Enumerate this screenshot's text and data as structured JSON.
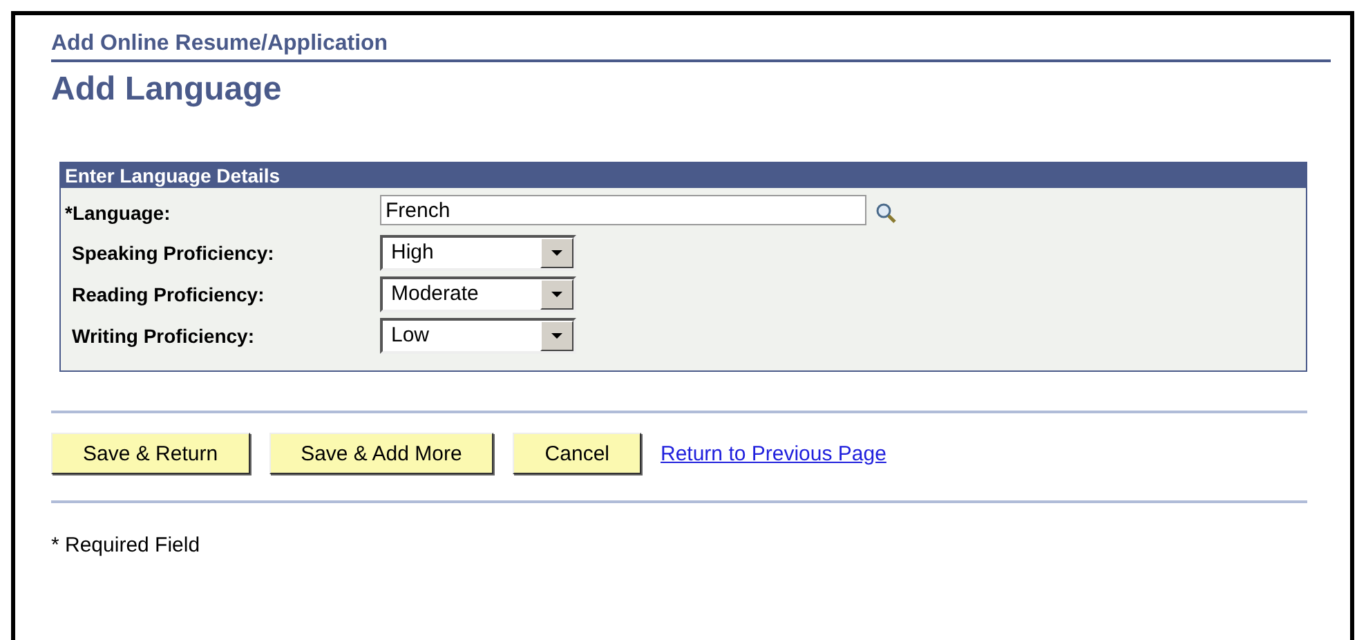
{
  "page": {
    "breadcrumb": "Add Online Resume/Application",
    "title": "Add Language"
  },
  "section": {
    "title": "Enter Language Details",
    "fields": [
      {
        "kind": "lookup",
        "label": "*Language:",
        "value": "French"
      },
      {
        "kind": "dropdown",
        "label": "Speaking Proficiency:",
        "value": "High"
      },
      {
        "kind": "dropdown",
        "label": "Reading Proficiency:",
        "value": "Moderate"
      },
      {
        "kind": "dropdown",
        "label": "Writing Proficiency:",
        "value": "Low"
      }
    ]
  },
  "buttons": [
    "Save & Return",
    "Save & Add More",
    "Cancel"
  ],
  "link": "Return to Previous Page",
  "footnote": "* Required Field"
}
